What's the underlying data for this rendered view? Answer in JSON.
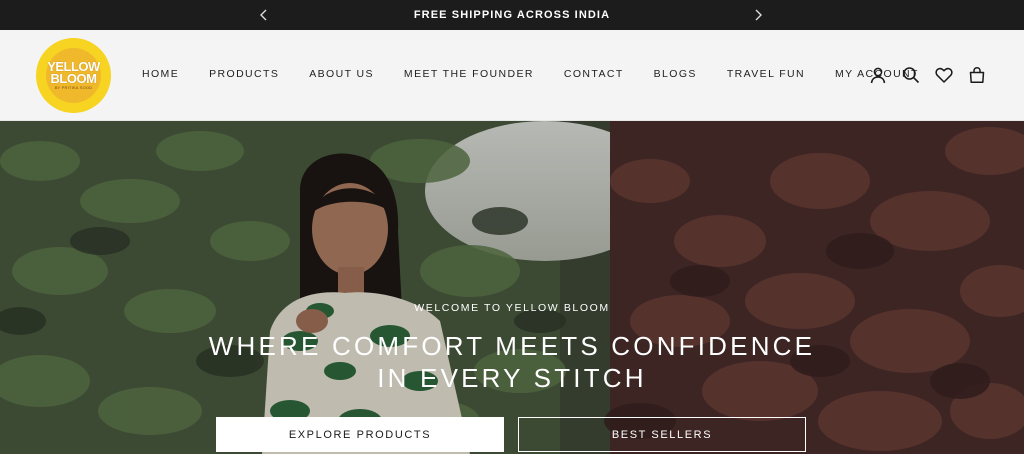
{
  "announcement": {
    "message": "FREE SHIPPING ACROSS INDIA",
    "prev_icon": "chevron-left-icon",
    "next_icon": "chevron-right-icon"
  },
  "logo": {
    "line1": "YELLOW",
    "line2": "BLOOM",
    "tagline": "BY PRITIKA SOOD",
    "color": "#f6d421"
  },
  "nav": {
    "items": [
      "HOME",
      "PRODUCTS",
      "ABOUT US",
      "MEET THE FOUNDER",
      "CONTACT",
      "BLOGS",
      "TRAVEL FUN",
      "MY ACCOUNT"
    ]
  },
  "header_icons": [
    "account-icon",
    "search-icon",
    "wishlist-heart-icon",
    "cart-bag-icon"
  ],
  "hero": {
    "kicker": "WELCOME TO YELLOW BLOOM",
    "headline_line1": "WHERE COMFORT MEETS CONFIDENCE",
    "headline_line2": "IN EVERY STITCH",
    "primary_button": "EXPLORE PRODUCTS",
    "secondary_button": "BEST SELLERS"
  },
  "colors": {
    "announcement_bg": "#1c1c1c",
    "header_bg": "#f4f4f4",
    "brand_yellow": "#f6d421"
  }
}
